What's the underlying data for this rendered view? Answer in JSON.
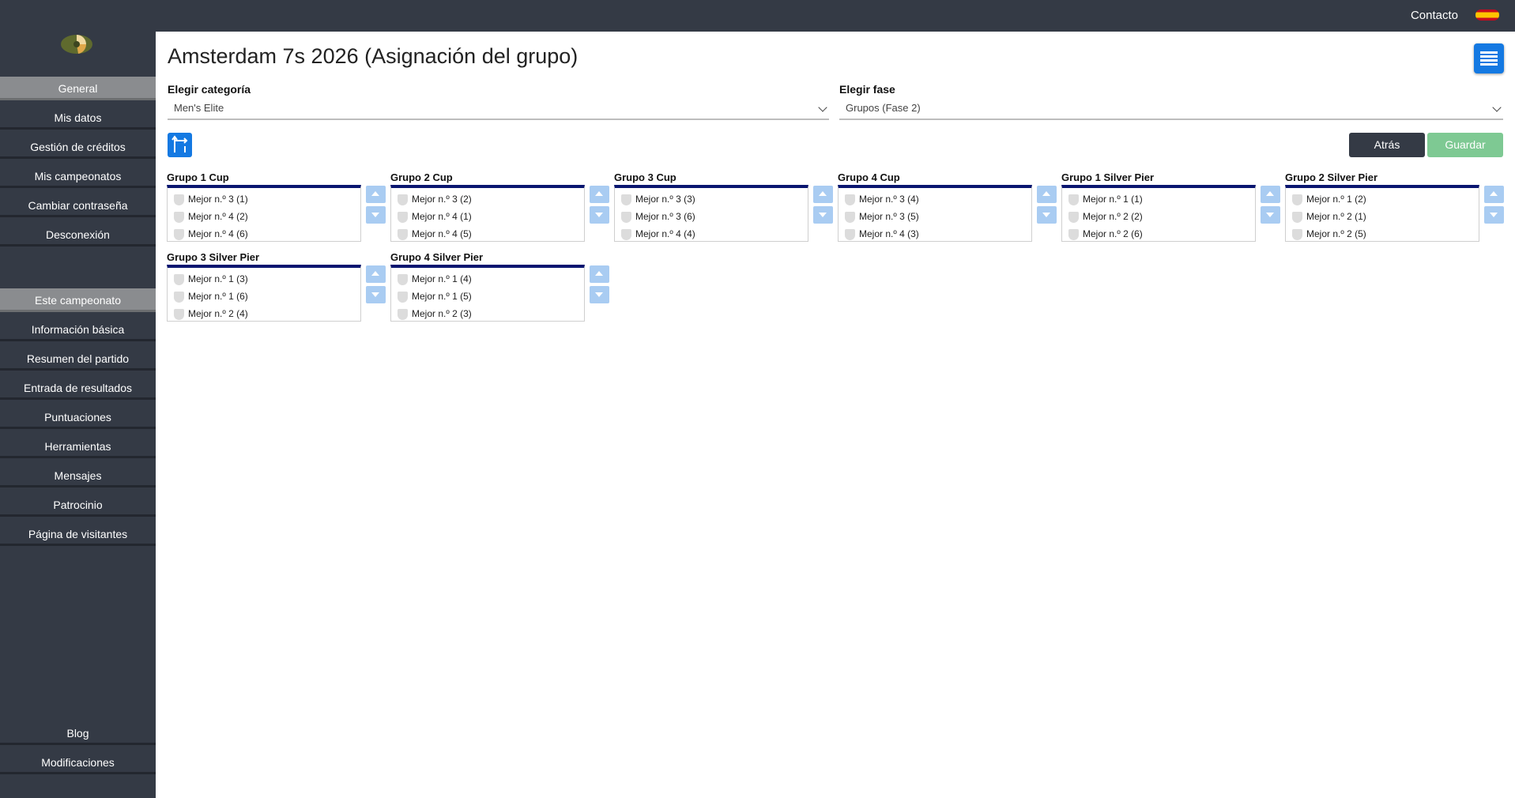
{
  "topbar": {
    "contact": "Contacto"
  },
  "sidebar": {
    "general": "General",
    "items_general": [
      "Mis datos",
      "Gestión de créditos",
      "Mis campeonatos",
      "Cambiar contraseña",
      "Desconexión"
    ],
    "championship": "Este campeonato",
    "items_championship": [
      "Información básica",
      "Resumen del partido",
      "Entrada de resultados",
      "Puntuaciones",
      "Herramientas",
      "Mensajes",
      "Patrocinio",
      "Página de visitantes"
    ],
    "bottom": [
      "Blog",
      "Modificaciones"
    ]
  },
  "page": {
    "title": "Amsterdam 7s 2026 (Asignación del grupo)"
  },
  "filters": {
    "category_label": "Elegir categoría",
    "category_value": "Men's Elite",
    "phase_label": "Elegir fase",
    "phase_value": "Grupos (Fase 2)"
  },
  "actions": {
    "back": "Atrás",
    "save": "Guardar"
  },
  "groups": [
    {
      "name": "Grupo 1 Cup",
      "teams": [
        "Mejor n.º 3 (1)",
        "Mejor n.º 4 (2)",
        "Mejor n.º 4 (6)"
      ]
    },
    {
      "name": "Grupo 2 Cup",
      "teams": [
        "Mejor n.º 3 (2)",
        "Mejor n.º 4 (1)",
        "Mejor n.º 4 (5)"
      ]
    },
    {
      "name": "Grupo 3 Cup",
      "teams": [
        "Mejor n.º 3 (3)",
        "Mejor n.º 3 (6)",
        "Mejor n.º 4 (4)"
      ]
    },
    {
      "name": "Grupo 4 Cup",
      "teams": [
        "Mejor n.º 3 (4)",
        "Mejor n.º 3 (5)",
        "Mejor n.º 4 (3)"
      ]
    },
    {
      "name": "Grupo 1 Silver Pier",
      "teams": [
        "Mejor n.º 1 (1)",
        "Mejor n.º 2 (2)",
        "Mejor n.º 2 (6)"
      ]
    },
    {
      "name": "Grupo 2 Silver Pier",
      "teams": [
        "Mejor n.º 1 (2)",
        "Mejor n.º 2 (1)",
        "Mejor n.º 2 (5)"
      ]
    },
    {
      "name": "Grupo 3 Silver Pier",
      "teams": [
        "Mejor n.º 1 (3)",
        "Mejor n.º 1 (6)",
        "Mejor n.º 2 (4)"
      ]
    },
    {
      "name": "Grupo 4 Silver Pier",
      "teams": [
        "Mejor n.º 1 (4)",
        "Mejor n.º 1 (5)",
        "Mejor n.º 2 (3)"
      ]
    }
  ],
  "colors": {
    "sidebar": "#343a45",
    "accent": "#1479e2",
    "group_border": "#0a1670",
    "save": "#7ec993"
  }
}
